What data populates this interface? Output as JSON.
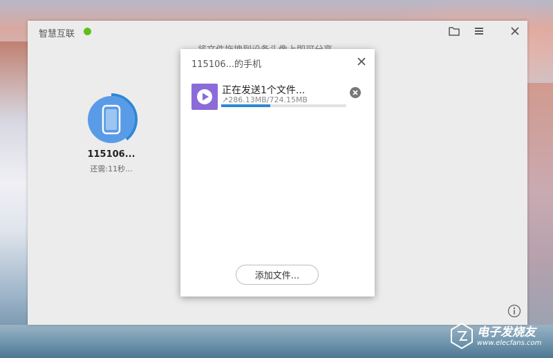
{
  "app": {
    "title": "智慧互联",
    "status_color": "#5ec11b",
    "hint": "将文件拖拽到设备头像上即可分享"
  },
  "toolbar": {
    "icons": [
      "folder-icon",
      "menu-icon",
      "close-icon"
    ]
  },
  "device": {
    "name": "115106...",
    "remaining": "还需:11秒...",
    "transfer_progress": 0.395,
    "avatar_color": "#5a9be8",
    "ring_color": "#2c87d9"
  },
  "dialog": {
    "title": "115106...的手机",
    "file": {
      "status": "正在发送1个文件...",
      "size": "↗286.13MB/724.15MB",
      "progress": 0.395,
      "icon": "play-icon",
      "icon_color": "#8a6bd9"
    },
    "add_button": "添加文件..."
  },
  "watermark": {
    "title": "电子发烧友",
    "url": "www.elecfans.com"
  }
}
